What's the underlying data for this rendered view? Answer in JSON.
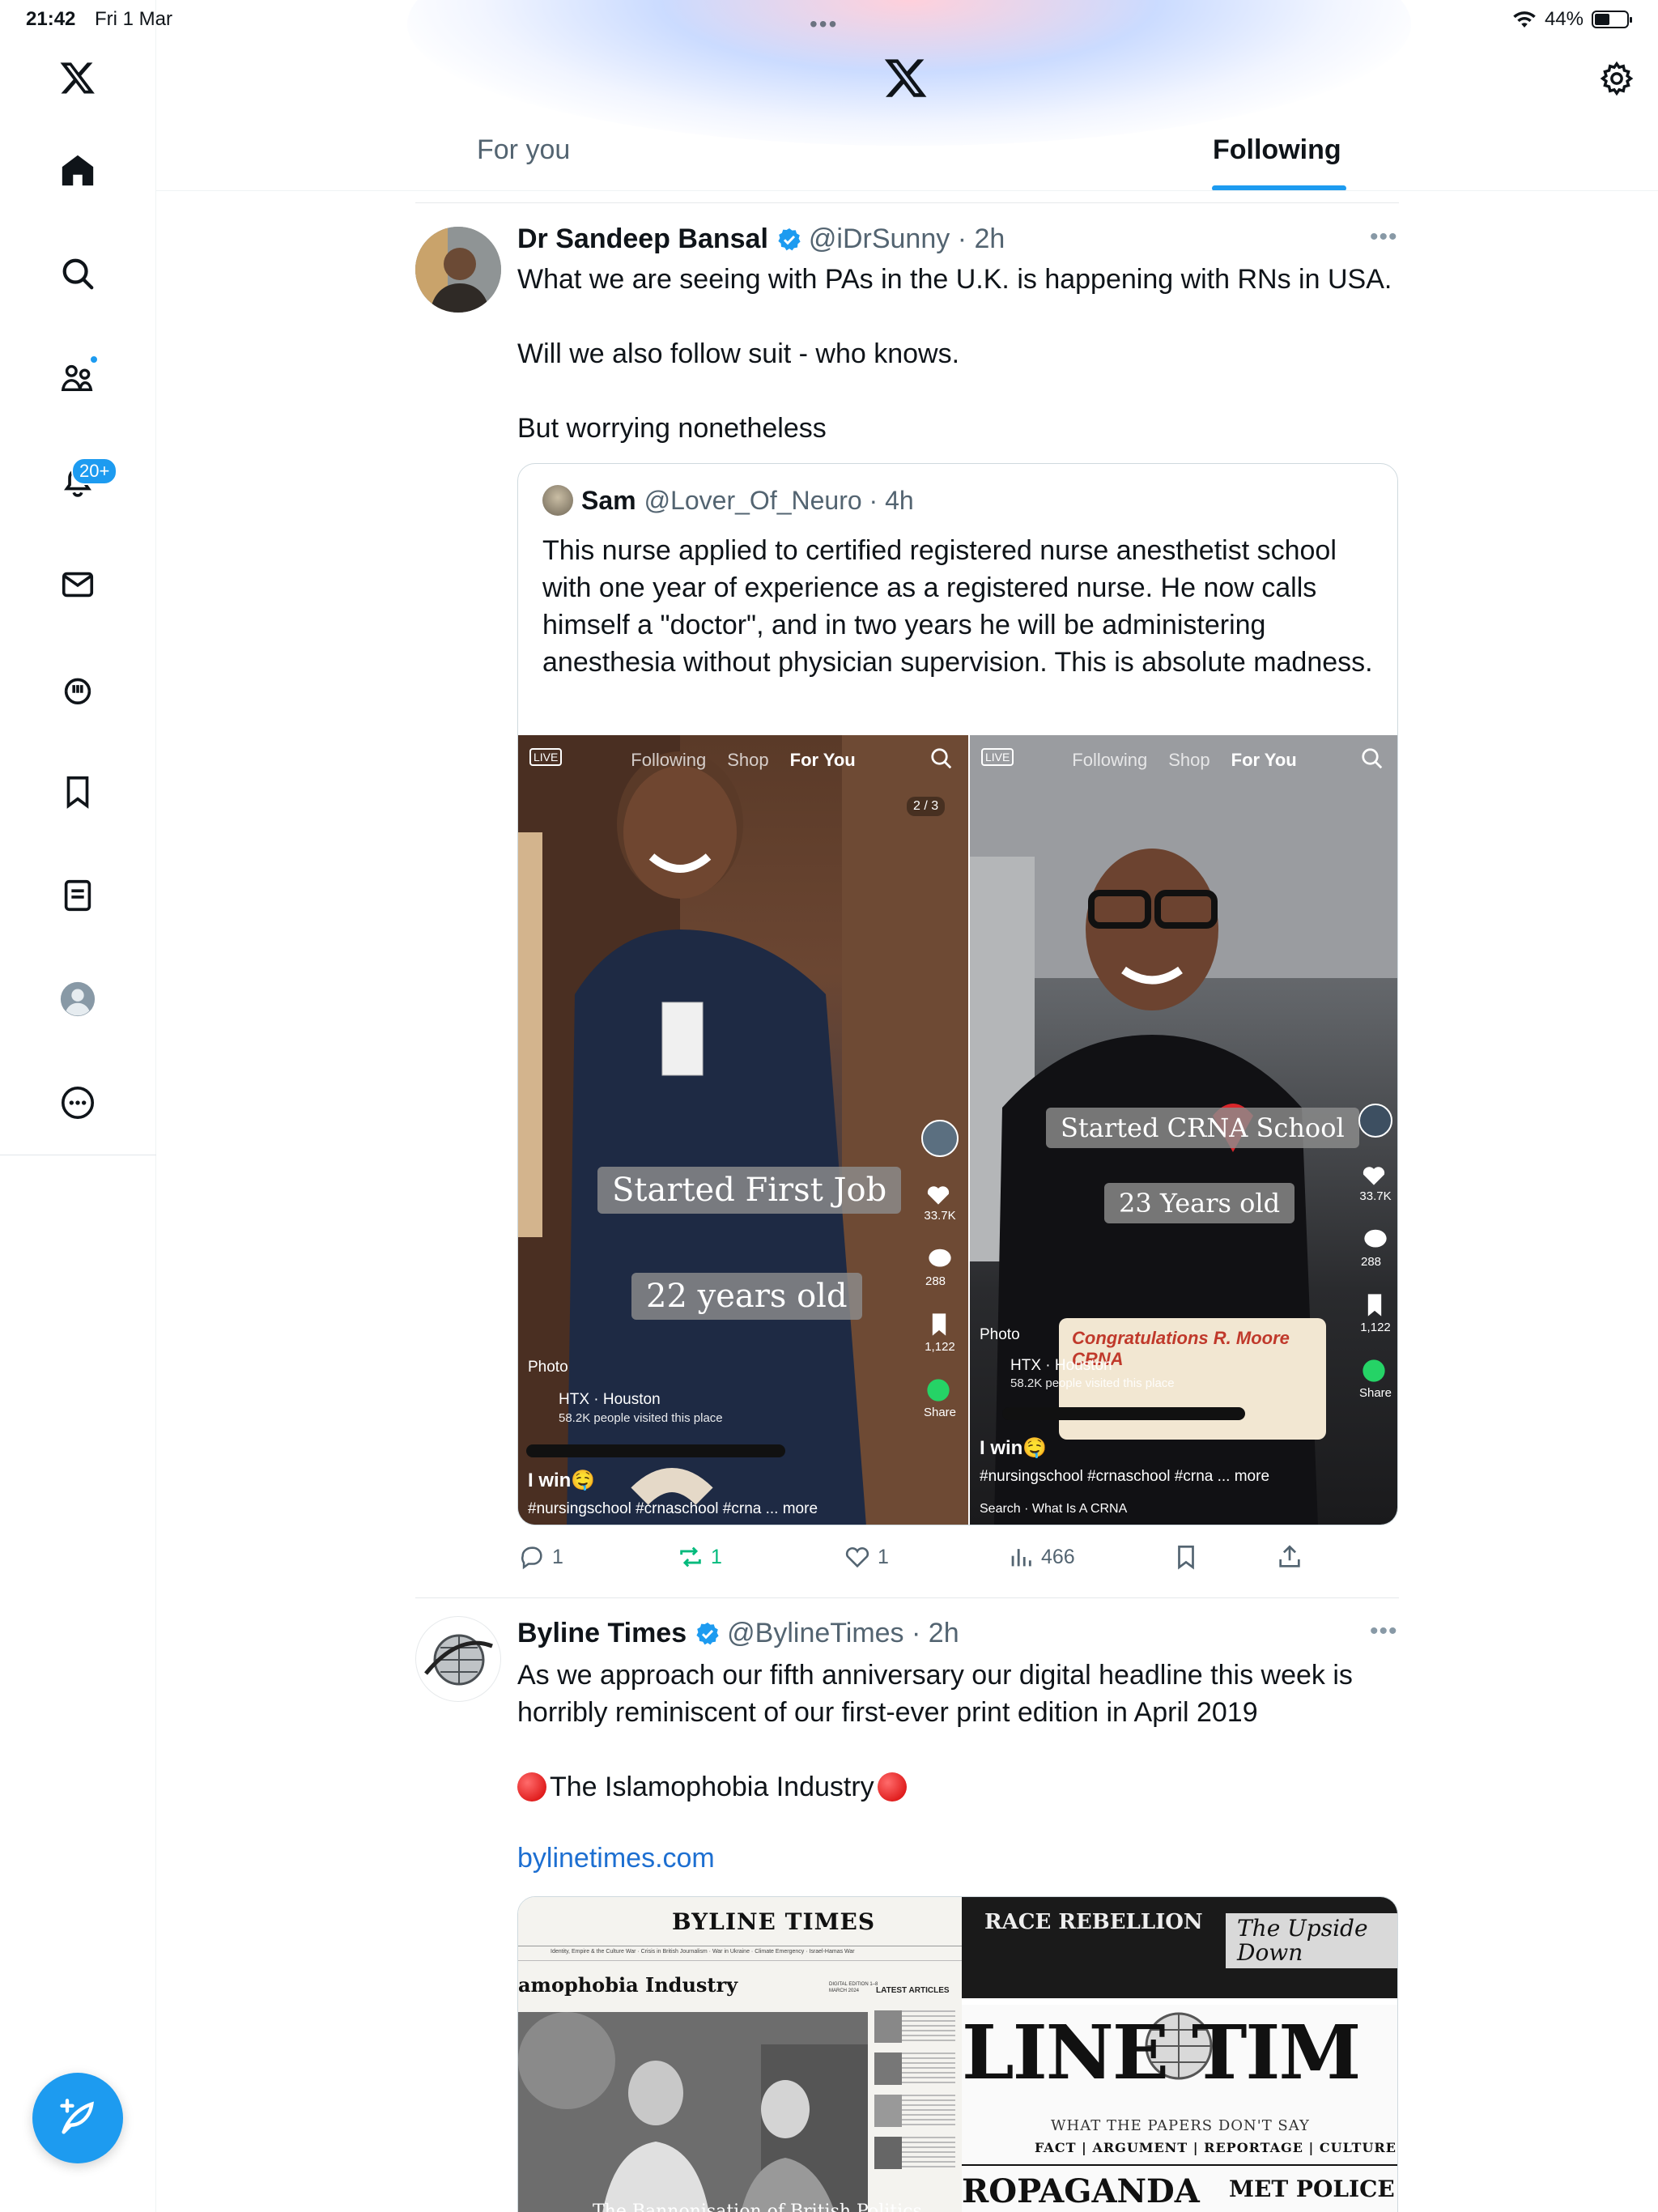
{
  "status_bar": {
    "time": "21:42",
    "date": "Fri 1 Mar",
    "battery": "44%"
  },
  "sidebar": {
    "items": [
      {
        "name": "x-logo-icon"
      },
      {
        "name": "home-icon"
      },
      {
        "name": "search-icon"
      },
      {
        "name": "communities-icon"
      },
      {
        "name": "notifications-icon"
      },
      {
        "name": "messages-icon"
      },
      {
        "name": "grok-icon"
      },
      {
        "name": "bookmarks-icon"
      },
      {
        "name": "lists-icon"
      },
      {
        "name": "profile-icon"
      },
      {
        "name": "more-icon"
      }
    ],
    "notifications_badge": "20+"
  },
  "header": {
    "tabs": [
      {
        "label": "For you"
      },
      {
        "label": "Following"
      }
    ],
    "active_tab": "Following"
  },
  "colors": {
    "accent": "#1d9bf0",
    "text": "#0f1419",
    "muted": "#536471",
    "repost": "#00ba7c"
  },
  "posts": [
    {
      "author": "Dr Sandeep Bansal",
      "handle": "@iDrSunny",
      "time": "2h",
      "text_lines": [
        "What we are seeing with PAs in the U.K. is happening with RNs in USA.",
        "Will we also follow suit - who knows.",
        "But worrying nonetheless"
      ],
      "quote": {
        "author": "Sam",
        "handle": "@Lover_Of_Neuro",
        "time": "4h",
        "text": "This nurse applied to certified registered nurse anesthetist school with one year of experience as a registered nurse. He now calls himself a \"doctor\", and in two years he will be administering anesthesia without physician supervision. This is absolute madness.",
        "media": [
          {
            "tabs": [
              "Following",
              "Shop",
              "For You"
            ],
            "page": "2 / 3",
            "caption1": "Started First Job",
            "caption2": "22 years old",
            "likes": "33.7K",
            "comments": "288",
            "saves": "1,122",
            "share": "Share",
            "photo_label": "Photo",
            "location": "HTX · Houston",
            "visits": "58.2K people visited this place",
            "title": "I win🤤",
            "hashtags": "#nursingschool #crnaschool #crna ... more"
          },
          {
            "tabs": [
              "Following",
              "Shop",
              "For You"
            ],
            "caption1": "Started CRNA School",
            "caption2": "23 Years old",
            "likes": "33.7K",
            "comments": "288",
            "saves": "1,122",
            "share": "Share",
            "photo_label": "Photo",
            "location": "HTX · Houston",
            "visits": "58.2K people visited this place",
            "cake_text": "Congratulations R. Moore CRNA",
            "title": "I win🤤",
            "hashtags": "#nursingschool #crnaschool #crna ... more",
            "search": "Search · What Is A CRNA"
          }
        ]
      },
      "stats": {
        "replies": "1",
        "reposts": "1",
        "likes": "1",
        "views": "466"
      }
    },
    {
      "author": "Byline Times",
      "handle": "@BylineTimes",
      "time": "2h",
      "text_lines": [
        "As we approach our fifth anniversary our digital headline this week is",
        "horribly reminiscent of our first-ever print edition in April 2019",
        "The Islamophobia Industry"
      ],
      "link": "bylinetimes.com",
      "card": {
        "masthead": "BYLINE TIMES",
        "nav": "Identity, Empire & the Culture War · Crisis in British Journalism · War in Ukraine · Climate Emergency · Israel-Hamas War",
        "headline": "amophobia Industry",
        "latest": "LATEST ARTICLES",
        "edition": "DIGITAL EDITION 1–8 MARCH 2024",
        "photo_caption": "The Bannonisation of British Politics",
        "print_top_left": "RACE REBELLION",
        "print_top_right": "The Upside Down",
        "print_masthead": "LINE TIM",
        "print_tagline": "WHAT THE PAPERS DON'T SAY",
        "print_sections": "FACT | ARGUMENT | REPORTAGE | CULTURE",
        "print_bottom_left": "ROPAGANDA",
        "print_bottom_right": "MET POLICE AC"
      }
    }
  ]
}
